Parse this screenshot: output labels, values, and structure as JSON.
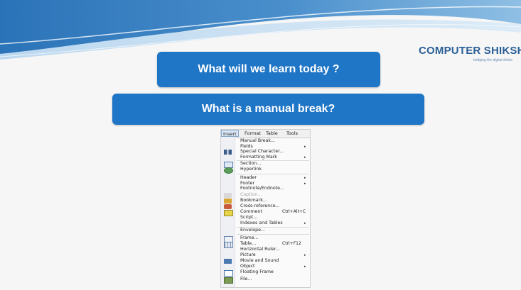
{
  "brand": {
    "name": "COMPUTER SHIKSHA",
    "tagline": "bridging the digital divide"
  },
  "headings": {
    "title": "What will we learn today ?",
    "subtitle": "What is a manual break?"
  },
  "menu_bar": [
    "Insert",
    "Format",
    "Table",
    "Tools"
  ],
  "menu_items": [
    {
      "label": "Manual Break...",
      "shortcut": "",
      "submenu": false,
      "disabled": false,
      "icon": ""
    },
    {
      "label": "Fields",
      "shortcut": "",
      "submenu": true,
      "disabled": false,
      "icon": ""
    },
    {
      "label": "Special Character...",
      "shortcut": "",
      "submenu": false,
      "disabled": false,
      "icon": "special-character-icon"
    },
    {
      "label": "Formatting Mark",
      "shortcut": "",
      "submenu": true,
      "disabled": false,
      "icon": ""
    },
    {
      "label": "Section...",
      "shortcut": "",
      "submenu": false,
      "disabled": false,
      "icon": "section-icon"
    },
    {
      "label": "Hyperlink",
      "shortcut": "",
      "submenu": false,
      "disabled": false,
      "icon": "hyperlink-icon"
    },
    {
      "label": "Header",
      "shortcut": "",
      "submenu": true,
      "disabled": false,
      "icon": ""
    },
    {
      "label": "Footer",
      "shortcut": "",
      "submenu": true,
      "disabled": false,
      "icon": ""
    },
    {
      "label": "Footnote/Endnote...",
      "shortcut": "",
      "submenu": false,
      "disabled": false,
      "icon": ""
    },
    {
      "label": "Caption...",
      "shortcut": "",
      "submenu": false,
      "disabled": true,
      "icon": "caption-icon"
    },
    {
      "label": "Bookmark...",
      "shortcut": "",
      "submenu": false,
      "disabled": false,
      "icon": "bookmark-icon"
    },
    {
      "label": "Cross-reference...",
      "shortcut": "",
      "submenu": false,
      "disabled": false,
      "icon": "cross-reference-icon"
    },
    {
      "label": "Comment",
      "shortcut": "Ctrl+Alt+C",
      "submenu": false,
      "disabled": false,
      "icon": "comment-icon"
    },
    {
      "label": "Script...",
      "shortcut": "",
      "submenu": false,
      "disabled": false,
      "icon": ""
    },
    {
      "label": "Indexes and Tables",
      "shortcut": "",
      "submenu": true,
      "disabled": false,
      "icon": ""
    },
    {
      "label": "Envelope...",
      "shortcut": "",
      "submenu": false,
      "disabled": false,
      "icon": ""
    },
    {
      "label": "Frame...",
      "shortcut": "",
      "submenu": false,
      "disabled": false,
      "icon": "frame-icon"
    },
    {
      "label": "Table...",
      "shortcut": "Ctrl+F12",
      "submenu": false,
      "disabled": false,
      "icon": "table-icon"
    },
    {
      "label": "Horizontal Ruler...",
      "shortcut": "",
      "submenu": false,
      "disabled": false,
      "icon": ""
    },
    {
      "label": "Picture",
      "shortcut": "",
      "submenu": true,
      "disabled": false,
      "icon": ""
    },
    {
      "label": "Movie and Sound",
      "shortcut": "",
      "submenu": false,
      "disabled": false,
      "icon": "movie-sound-icon"
    },
    {
      "label": "Object",
      "shortcut": "",
      "submenu": true,
      "disabled": false,
      "icon": ""
    },
    {
      "label": "Floating Frame",
      "shortcut": "",
      "submenu": false,
      "disabled": false,
      "icon": "floating-frame-icon"
    },
    {
      "label": "File...",
      "shortcut": "",
      "submenu": false,
      "disabled": false,
      "icon": "file-icon"
    }
  ],
  "colors": {
    "pill": "#1f75c6",
    "wave_dark": "#2b73b8",
    "wave_light": "#a9cdea"
  }
}
